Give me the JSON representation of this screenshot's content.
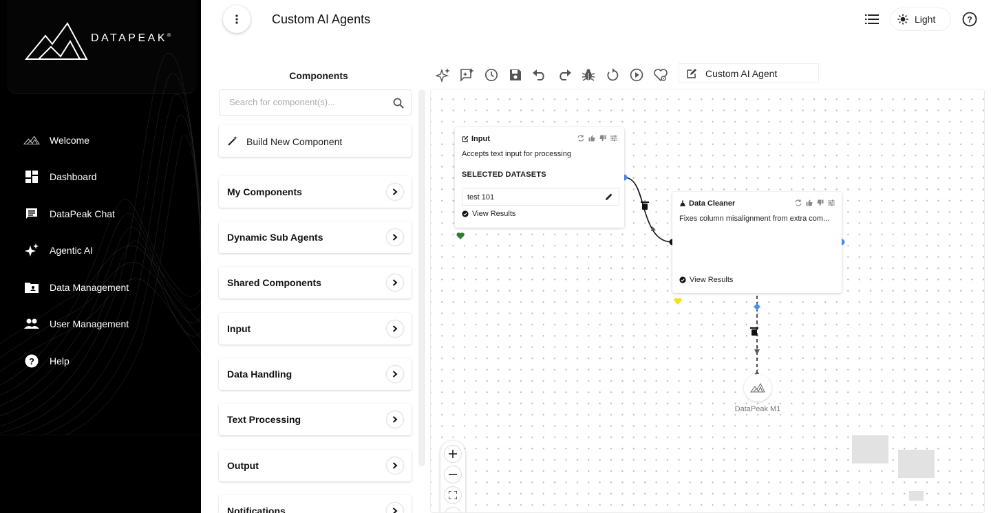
{
  "brand": {
    "name": "DATAPEAK",
    "mark": "®"
  },
  "nav": [
    {
      "label": "Welcome",
      "icon": "mountain-icon"
    },
    {
      "label": "Dashboard",
      "icon": "dashboard-icon"
    },
    {
      "label": "DataPeak Chat",
      "icon": "chat-icon"
    },
    {
      "label": "Agentic AI",
      "icon": "sparkle-icon"
    },
    {
      "label": "Data Management",
      "icon": "folder-icon"
    },
    {
      "label": "User Management",
      "icon": "users-icon"
    },
    {
      "label": "Help",
      "icon": "help-icon"
    }
  ],
  "header": {
    "title": "Custom AI Agents",
    "theme_label": "Light"
  },
  "components": {
    "title": "Components",
    "search_placeholder": "Search for component(s)...",
    "build_label": "Build New Component",
    "categories": [
      "My Components",
      "Dynamic Sub Agents",
      "Shared Components",
      "Input",
      "Data Handling",
      "Text Processing",
      "Output",
      "Notifications"
    ]
  },
  "toolbar": {
    "agent_name": "Custom AI Agent",
    "tools": [
      "sparkle-icon",
      "ai-chat-icon",
      "history-icon",
      "save-icon",
      "undo-icon",
      "redo-icon",
      "bug-icon",
      "reset-icon",
      "play-icon",
      "heart-settings-icon"
    ]
  },
  "canvas": {
    "input_node": {
      "title": "Input",
      "description": "Accepts text input for processing",
      "datasets_label": "SELECTED DATASETS",
      "dataset": "test 101",
      "view_results": "View Results",
      "status_color": "#2e7d32"
    },
    "cleaner_node": {
      "title": "Data Cleaner",
      "description": "Fixes column misalignment from extra com...",
      "view_results": "View Results",
      "status_color": "#f2e21f"
    },
    "model_node": {
      "label": "DataPeak M1"
    },
    "accent": "#4f8ef0"
  }
}
